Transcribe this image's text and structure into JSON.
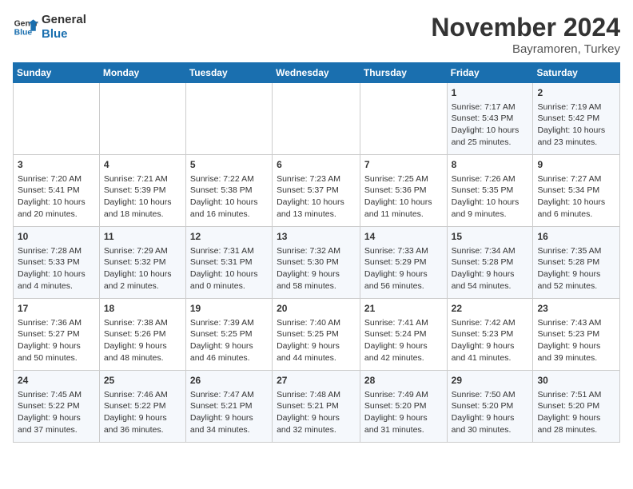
{
  "header": {
    "logo_line1": "General",
    "logo_line2": "Blue",
    "month_title": "November 2024",
    "location": "Bayramoren, Turkey"
  },
  "days_of_week": [
    "Sunday",
    "Monday",
    "Tuesday",
    "Wednesday",
    "Thursday",
    "Friday",
    "Saturday"
  ],
  "weeks": [
    [
      {
        "day": "",
        "content": ""
      },
      {
        "day": "",
        "content": ""
      },
      {
        "day": "",
        "content": ""
      },
      {
        "day": "",
        "content": ""
      },
      {
        "day": "",
        "content": ""
      },
      {
        "day": "1",
        "content": "Sunrise: 7:17 AM\nSunset: 5:43 PM\nDaylight: 10 hours and 25 minutes."
      },
      {
        "day": "2",
        "content": "Sunrise: 7:19 AM\nSunset: 5:42 PM\nDaylight: 10 hours and 23 minutes."
      }
    ],
    [
      {
        "day": "3",
        "content": "Sunrise: 7:20 AM\nSunset: 5:41 PM\nDaylight: 10 hours and 20 minutes."
      },
      {
        "day": "4",
        "content": "Sunrise: 7:21 AM\nSunset: 5:39 PM\nDaylight: 10 hours and 18 minutes."
      },
      {
        "day": "5",
        "content": "Sunrise: 7:22 AM\nSunset: 5:38 PM\nDaylight: 10 hours and 16 minutes."
      },
      {
        "day": "6",
        "content": "Sunrise: 7:23 AM\nSunset: 5:37 PM\nDaylight: 10 hours and 13 minutes."
      },
      {
        "day": "7",
        "content": "Sunrise: 7:25 AM\nSunset: 5:36 PM\nDaylight: 10 hours and 11 minutes."
      },
      {
        "day": "8",
        "content": "Sunrise: 7:26 AM\nSunset: 5:35 PM\nDaylight: 10 hours and 9 minutes."
      },
      {
        "day": "9",
        "content": "Sunrise: 7:27 AM\nSunset: 5:34 PM\nDaylight: 10 hours and 6 minutes."
      }
    ],
    [
      {
        "day": "10",
        "content": "Sunrise: 7:28 AM\nSunset: 5:33 PM\nDaylight: 10 hours and 4 minutes."
      },
      {
        "day": "11",
        "content": "Sunrise: 7:29 AM\nSunset: 5:32 PM\nDaylight: 10 hours and 2 minutes."
      },
      {
        "day": "12",
        "content": "Sunrise: 7:31 AM\nSunset: 5:31 PM\nDaylight: 10 hours and 0 minutes."
      },
      {
        "day": "13",
        "content": "Sunrise: 7:32 AM\nSunset: 5:30 PM\nDaylight: 9 hours and 58 minutes."
      },
      {
        "day": "14",
        "content": "Sunrise: 7:33 AM\nSunset: 5:29 PM\nDaylight: 9 hours and 56 minutes."
      },
      {
        "day": "15",
        "content": "Sunrise: 7:34 AM\nSunset: 5:28 PM\nDaylight: 9 hours and 54 minutes."
      },
      {
        "day": "16",
        "content": "Sunrise: 7:35 AM\nSunset: 5:28 PM\nDaylight: 9 hours and 52 minutes."
      }
    ],
    [
      {
        "day": "17",
        "content": "Sunrise: 7:36 AM\nSunset: 5:27 PM\nDaylight: 9 hours and 50 minutes."
      },
      {
        "day": "18",
        "content": "Sunrise: 7:38 AM\nSunset: 5:26 PM\nDaylight: 9 hours and 48 minutes."
      },
      {
        "day": "19",
        "content": "Sunrise: 7:39 AM\nSunset: 5:25 PM\nDaylight: 9 hours and 46 minutes."
      },
      {
        "day": "20",
        "content": "Sunrise: 7:40 AM\nSunset: 5:25 PM\nDaylight: 9 hours and 44 minutes."
      },
      {
        "day": "21",
        "content": "Sunrise: 7:41 AM\nSunset: 5:24 PM\nDaylight: 9 hours and 42 minutes."
      },
      {
        "day": "22",
        "content": "Sunrise: 7:42 AM\nSunset: 5:23 PM\nDaylight: 9 hours and 41 minutes."
      },
      {
        "day": "23",
        "content": "Sunrise: 7:43 AM\nSunset: 5:23 PM\nDaylight: 9 hours and 39 minutes."
      }
    ],
    [
      {
        "day": "24",
        "content": "Sunrise: 7:45 AM\nSunset: 5:22 PM\nDaylight: 9 hours and 37 minutes."
      },
      {
        "day": "25",
        "content": "Sunrise: 7:46 AM\nSunset: 5:22 PM\nDaylight: 9 hours and 36 minutes."
      },
      {
        "day": "26",
        "content": "Sunrise: 7:47 AM\nSunset: 5:21 PM\nDaylight: 9 hours and 34 minutes."
      },
      {
        "day": "27",
        "content": "Sunrise: 7:48 AM\nSunset: 5:21 PM\nDaylight: 9 hours and 32 minutes."
      },
      {
        "day": "28",
        "content": "Sunrise: 7:49 AM\nSunset: 5:20 PM\nDaylight: 9 hours and 31 minutes."
      },
      {
        "day": "29",
        "content": "Sunrise: 7:50 AM\nSunset: 5:20 PM\nDaylight: 9 hours and 30 minutes."
      },
      {
        "day": "30",
        "content": "Sunrise: 7:51 AM\nSunset: 5:20 PM\nDaylight: 9 hours and 28 minutes."
      }
    ]
  ]
}
